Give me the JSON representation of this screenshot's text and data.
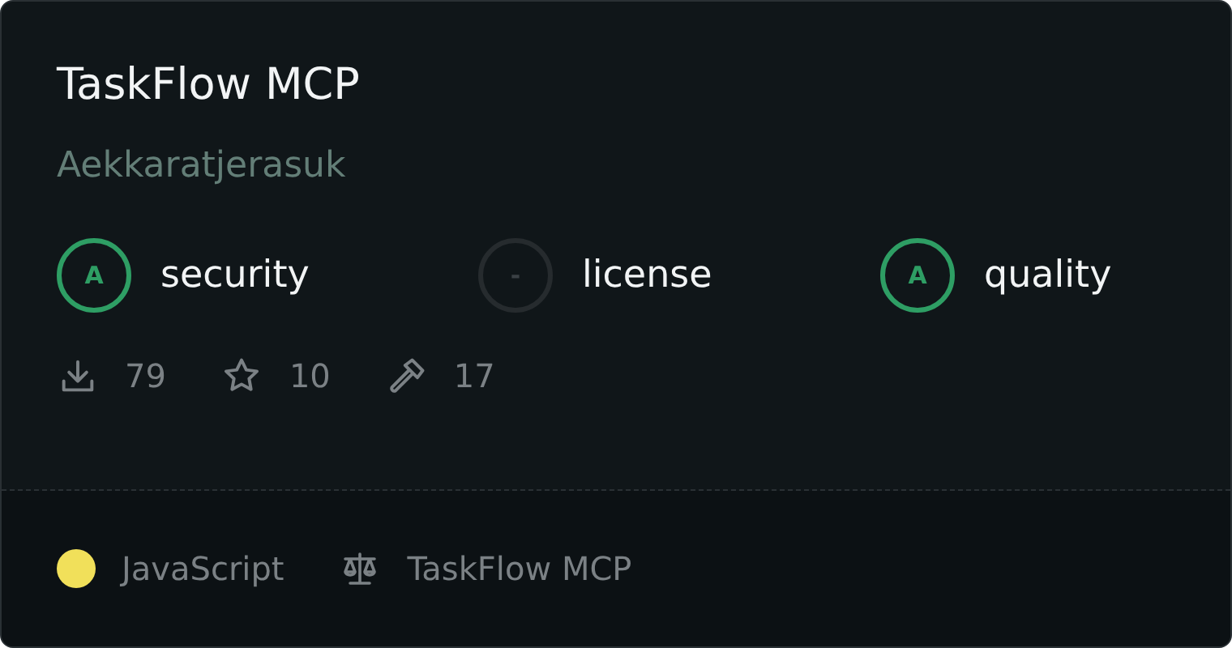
{
  "card": {
    "title": "TaskFlow MCP",
    "author": "Aekkaratjerasuk",
    "scores": [
      {
        "grade": "A",
        "label": "security",
        "color": "#2e9e64"
      },
      {
        "grade": "-",
        "label": "license",
        "color": "#262b2e"
      },
      {
        "grade": "A",
        "label": "quality",
        "color": "#2e9e64"
      }
    ],
    "stats": [
      {
        "kind": "downloads",
        "value": "79"
      },
      {
        "kind": "stars",
        "value": "10"
      },
      {
        "kind": "tools",
        "value": "17"
      }
    ],
    "footer": {
      "language": {
        "name": "JavaScript",
        "color": "#f1e05a"
      },
      "license": "TaskFlow MCP"
    }
  }
}
